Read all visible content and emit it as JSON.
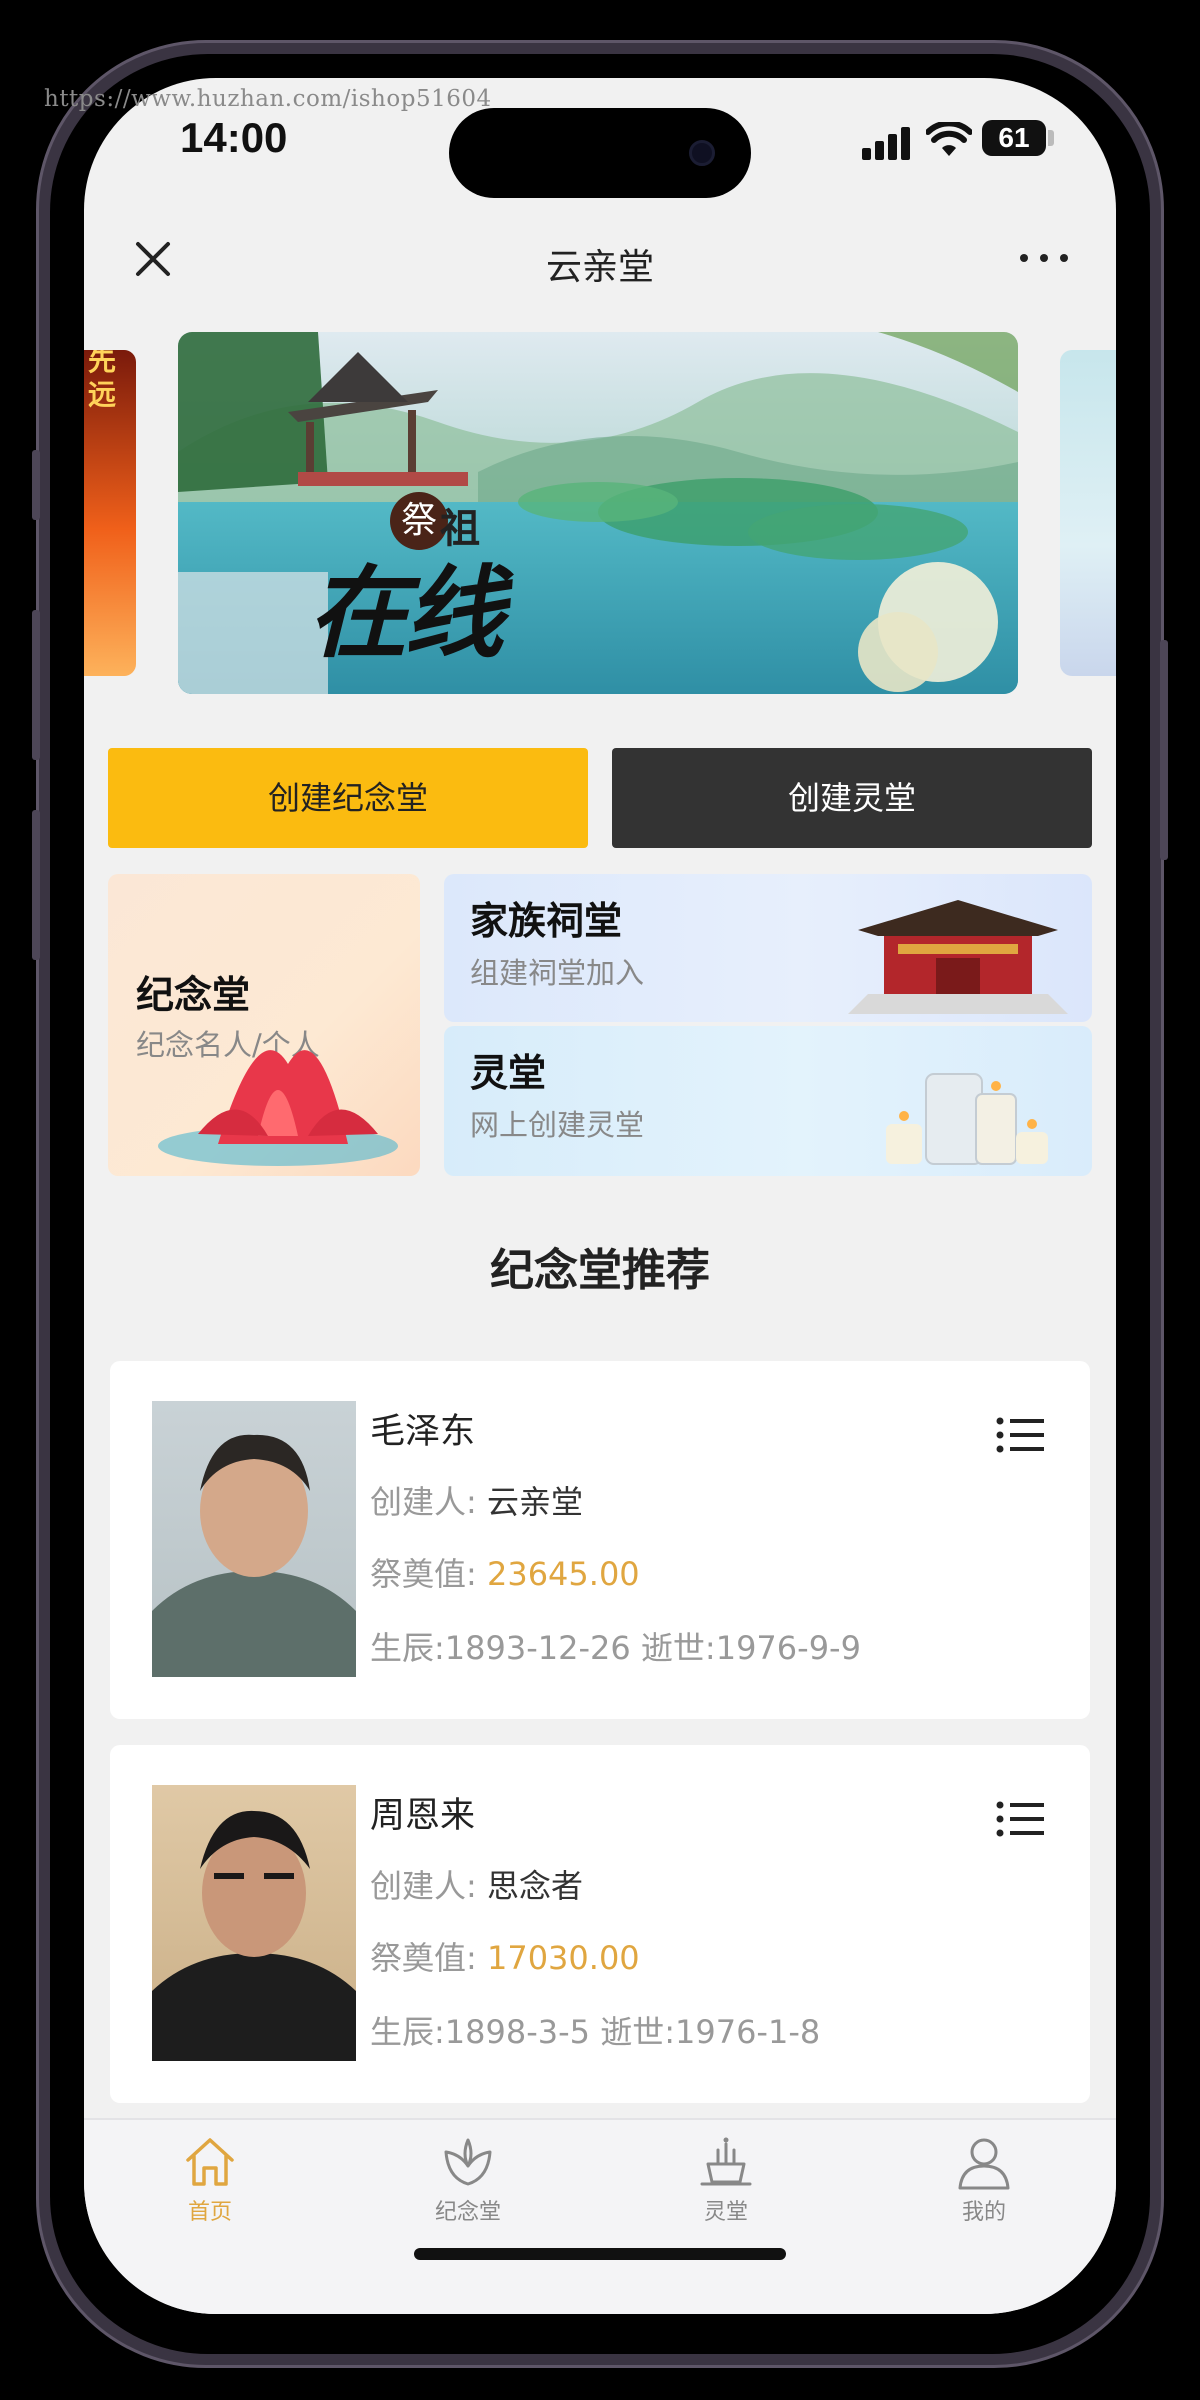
{
  "watermark": "https://www.huzhan.com/ishop51604",
  "status": {
    "time": "14:00",
    "battery": "61"
  },
  "nav": {
    "title": "云亲堂"
  },
  "banner": {
    "title_main": "在线",
    "seal_char": "祭",
    "title_side": "祖",
    "side_left_text": "先远"
  },
  "buttons": {
    "create_memorial": "创建纪念堂",
    "create_shrine": "创建灵堂"
  },
  "categories": [
    {
      "title": "纪念堂",
      "subtitle": "纪念名人/个人"
    },
    {
      "title": "家族祠堂",
      "subtitle": "组建祠堂加入"
    },
    {
      "title": "灵堂",
      "subtitle": "网上创建灵堂"
    }
  ],
  "section_title": "纪念堂推荐",
  "people": [
    {
      "name": "毛泽东",
      "creator_label": "创建人:",
      "creator": "云亲堂",
      "offering_label": "祭奠值:",
      "offering": "23645.00",
      "dates": "生辰:1893-12-26 逝世:1976-9-9"
    },
    {
      "name": "周恩来",
      "creator_label": "创建人:",
      "creator": "思念者",
      "offering_label": "祭奠值:",
      "offering": "17030.00",
      "dates": "生辰:1898-3-5 逝世:1976-1-8"
    }
  ],
  "tabs": [
    {
      "label": "首页",
      "icon": "home-icon",
      "active": true
    },
    {
      "label": "纪念堂",
      "icon": "lotus-icon",
      "active": false
    },
    {
      "label": "灵堂",
      "icon": "incense-icon",
      "active": false
    },
    {
      "label": "我的",
      "icon": "user-icon",
      "active": false
    }
  ],
  "colors": {
    "accent": "#fbbb10",
    "dark_button": "#333333",
    "gold_text": "#e0a640"
  }
}
